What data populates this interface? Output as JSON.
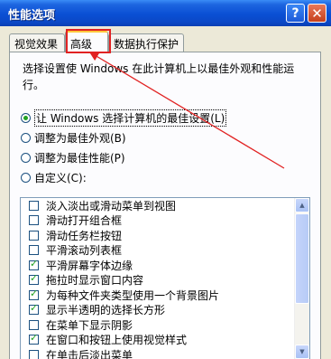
{
  "window": {
    "title": "性能选项",
    "help_glyph": "?",
    "close_glyph": "✕"
  },
  "tabs": [
    {
      "label": "视觉效果"
    },
    {
      "label": "高级"
    },
    {
      "label": "数据执行保护"
    }
  ],
  "description": {
    "line1": "选择设置使 Windows 在此计算机上以最佳外观和性能运",
    "line2": "行。"
  },
  "options": [
    {
      "label": "让 Windows 选择计算机的最佳设置(L)",
      "selected": true
    },
    {
      "label": "调整为最佳外观(B)",
      "selected": false
    },
    {
      "label": "调整为最佳性能(P)",
      "selected": false
    },
    {
      "label": "自定义(C):",
      "selected": false
    }
  ],
  "effects": [
    {
      "label": "淡入淡出或滑动菜单到视图",
      "checked": false
    },
    {
      "label": "滑动打开组合框",
      "checked": false
    },
    {
      "label": "滑动任务栏按钮",
      "checked": false
    },
    {
      "label": "平滑滚动列表框",
      "checked": false
    },
    {
      "label": "平滑屏幕字体边缘",
      "checked": true
    },
    {
      "label": "拖拉时显示窗口内容",
      "checked": true
    },
    {
      "label": "为每种文件夹类型使用一个背景图片",
      "checked": true
    },
    {
      "label": "显示半透明的选择长方形",
      "checked": true
    },
    {
      "label": "在菜单下显示阴影",
      "checked": false
    },
    {
      "label": "在窗口和按钮上使用视觉样式",
      "checked": true
    },
    {
      "label": "在单击后淡出菜单",
      "checked": false
    }
  ],
  "annotation": {
    "color": "#e12222"
  }
}
